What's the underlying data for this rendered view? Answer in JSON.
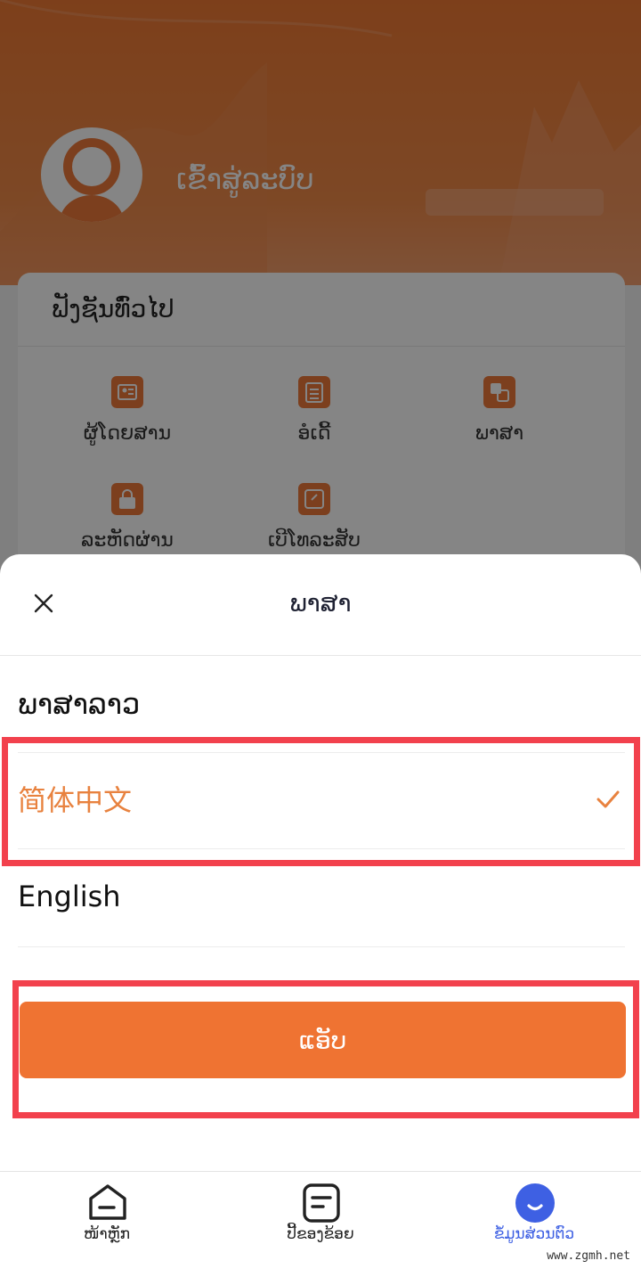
{
  "profile": {
    "login_text": "ເຂົ້າສູ່ລະບົບ"
  },
  "functions_card": {
    "title": "ຟັງຊັນທົ່ວໄປ",
    "items": [
      {
        "label": "ຜູ້ໂດຍສານ",
        "icon": "passenger-icon"
      },
      {
        "label": "ອໍເດີ້",
        "icon": "order-icon"
      },
      {
        "label": "ພາສາ",
        "icon": "language-icon"
      },
      {
        "label": "ລະຫັດຜ່ານ",
        "icon": "password-icon"
      },
      {
        "label": "ເບີໂທລະສັບ",
        "icon": "phone-icon"
      }
    ]
  },
  "language_sheet": {
    "title": "ພາສາ",
    "close_icon": "close-icon",
    "options": [
      {
        "label": "ພາສາລາວ",
        "selected": false
      },
      {
        "label": "简体中文",
        "selected": true
      },
      {
        "label": "English",
        "selected": false
      }
    ],
    "apply_label": "ແອັບ",
    "accent_color": "#ef7332",
    "highlight_color": "#f2414d"
  },
  "bottom_nav": {
    "items": [
      {
        "label": "ໜ້າຫຼັກ",
        "icon": "home-icon",
        "active": false
      },
      {
        "label": "ປີ້ຂອງຂ້ອຍ",
        "icon": "ticket-icon",
        "active": false
      },
      {
        "label": "ຂໍ້ມູນສ່ວນຕົວ",
        "icon": "profile-icon",
        "active": true
      }
    ]
  },
  "watermark": "www.zgmh.net"
}
